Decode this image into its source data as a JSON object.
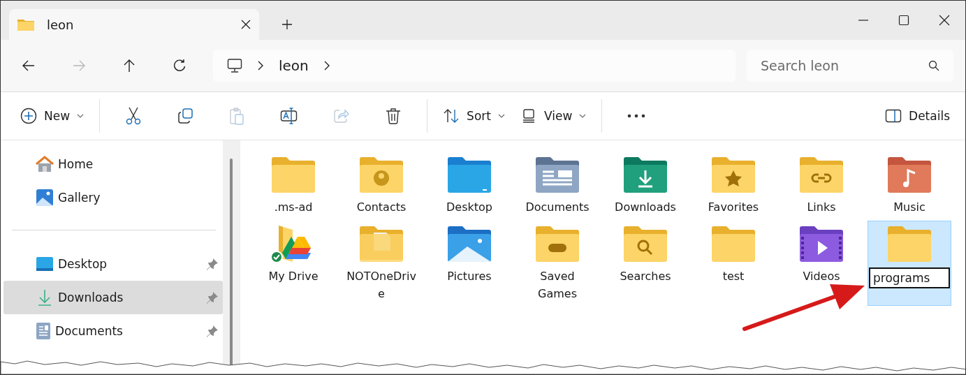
{
  "tabs": [
    {
      "title": "leon",
      "selected": true
    }
  ],
  "nav": [
    {
      "kind": "back",
      "disabled": false
    },
    {
      "kind": "forward",
      "disabled": true
    },
    {
      "kind": "up",
      "disabled": false
    },
    {
      "kind": "refresh",
      "disabled": false
    }
  ],
  "breadcrumb": {
    "items": [
      "leon"
    ]
  },
  "search": {
    "placeholder": "Search leon"
  },
  "toolbar": [
    {
      "kind": "new",
      "label": "New",
      "disabled": false
    },
    {
      "kind": "divider"
    },
    {
      "kind": "cut",
      "disabled": false
    },
    {
      "kind": "copy",
      "disabled": false
    },
    {
      "kind": "paste",
      "disabled": true
    },
    {
      "kind": "rename",
      "disabled": false
    },
    {
      "kind": "share",
      "disabled": true
    },
    {
      "kind": "delete",
      "disabled": false
    },
    {
      "kind": "divider"
    },
    {
      "kind": "sort",
      "label": "Sort",
      "disabled": false
    },
    {
      "kind": "view",
      "label": "View",
      "disabled": false
    },
    {
      "kind": "divider"
    },
    {
      "kind": "more",
      "disabled": false
    }
  ],
  "details_button": {
    "label": "Details"
  },
  "sidebar": {
    "groups": [
      [
        {
          "label": "Home",
          "kind": "home",
          "pinned": false,
          "selected": false
        },
        {
          "label": "Gallery",
          "kind": "gallery",
          "pinned": false,
          "selected": false
        }
      ],
      [
        {
          "label": "Desktop",
          "kind": "desktop",
          "pinned": true,
          "selected": false
        },
        {
          "label": "Downloads",
          "kind": "downloads",
          "pinned": true,
          "selected": true
        },
        {
          "label": "Documents",
          "kind": "documents",
          "pinned": true,
          "selected": false
        }
      ]
    ]
  },
  "items": [
    {
      "name": ".ms-ad",
      "kind": "plain",
      "selected": false,
      "renaming": false
    },
    {
      "name": "Contacts",
      "kind": "contacts",
      "selected": false,
      "renaming": false
    },
    {
      "name": "Desktop",
      "kind": "desktop",
      "selected": false,
      "renaming": false
    },
    {
      "name": "Documents",
      "kind": "documents",
      "selected": false,
      "renaming": false
    },
    {
      "name": "Downloads",
      "kind": "downloads",
      "selected": false,
      "renaming": false
    },
    {
      "name": "Favorites",
      "kind": "favorites",
      "selected": false,
      "renaming": false
    },
    {
      "name": "Links",
      "kind": "links",
      "selected": false,
      "renaming": false
    },
    {
      "name": "Music",
      "kind": "music",
      "selected": false,
      "renaming": false
    },
    {
      "name": "My Drive",
      "kind": "drive",
      "selected": false,
      "renaming": false
    },
    {
      "name": "NOTOneDrive",
      "kind": "papers",
      "selected": false,
      "renaming": false
    },
    {
      "name": "Pictures",
      "kind": "pictures",
      "selected": false,
      "renaming": false
    },
    {
      "name": "Saved Games",
      "kind": "games",
      "selected": false,
      "renaming": false
    },
    {
      "name": "Searches",
      "kind": "searches",
      "selected": false,
      "renaming": false
    },
    {
      "name": "test",
      "kind": "plain",
      "selected": false,
      "renaming": false
    },
    {
      "name": "Videos",
      "kind": "videos",
      "selected": false,
      "renaming": false
    },
    {
      "name": "programs",
      "kind": "plain",
      "selected": true,
      "renaming": true
    }
  ]
}
